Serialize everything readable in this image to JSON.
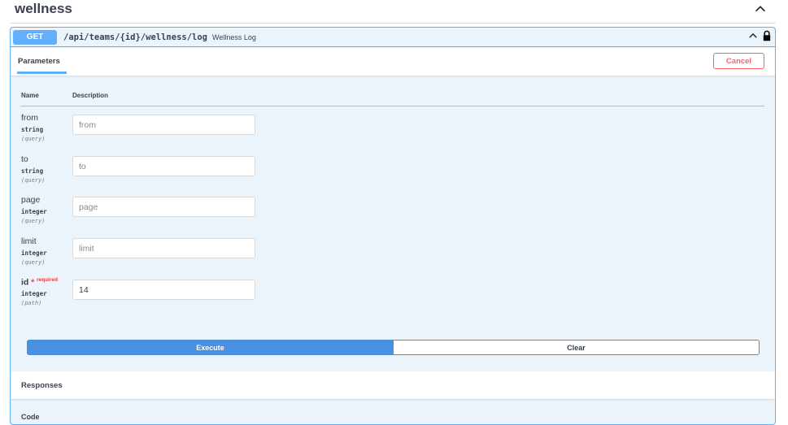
{
  "tag": {
    "title": "wellness",
    "chevron_icon": "chevron-up-icon"
  },
  "operation": {
    "method": "GET",
    "path": "/api/teams/{id}/wellness/log",
    "summary": "Wellness Log",
    "method_color": "#61affe"
  },
  "section": {
    "parameters_tab": "Parameters",
    "cancel_label": "Cancel"
  },
  "table": {
    "col_name": "Name",
    "col_description": "Description"
  },
  "params": [
    {
      "name": "from",
      "type": "string",
      "in": "(query)",
      "placeholder": "from",
      "value": ""
    },
    {
      "name": "to",
      "type": "string",
      "in": "(query)",
      "placeholder": "to",
      "value": ""
    },
    {
      "name": "page",
      "type": "integer",
      "in": "(query)",
      "placeholder": "page",
      "value": ""
    },
    {
      "name": "limit",
      "type": "integer",
      "in": "(query)",
      "placeholder": "limit",
      "value": ""
    },
    {
      "name": "id",
      "type": "integer",
      "in": "(path)",
      "placeholder": "id",
      "value": "14",
      "required_star": "*",
      "required_label": "required"
    }
  ],
  "actions": {
    "execute_label": "Execute",
    "clear_label": "Clear"
  },
  "responses": {
    "title": "Responses",
    "peek": "Code"
  }
}
